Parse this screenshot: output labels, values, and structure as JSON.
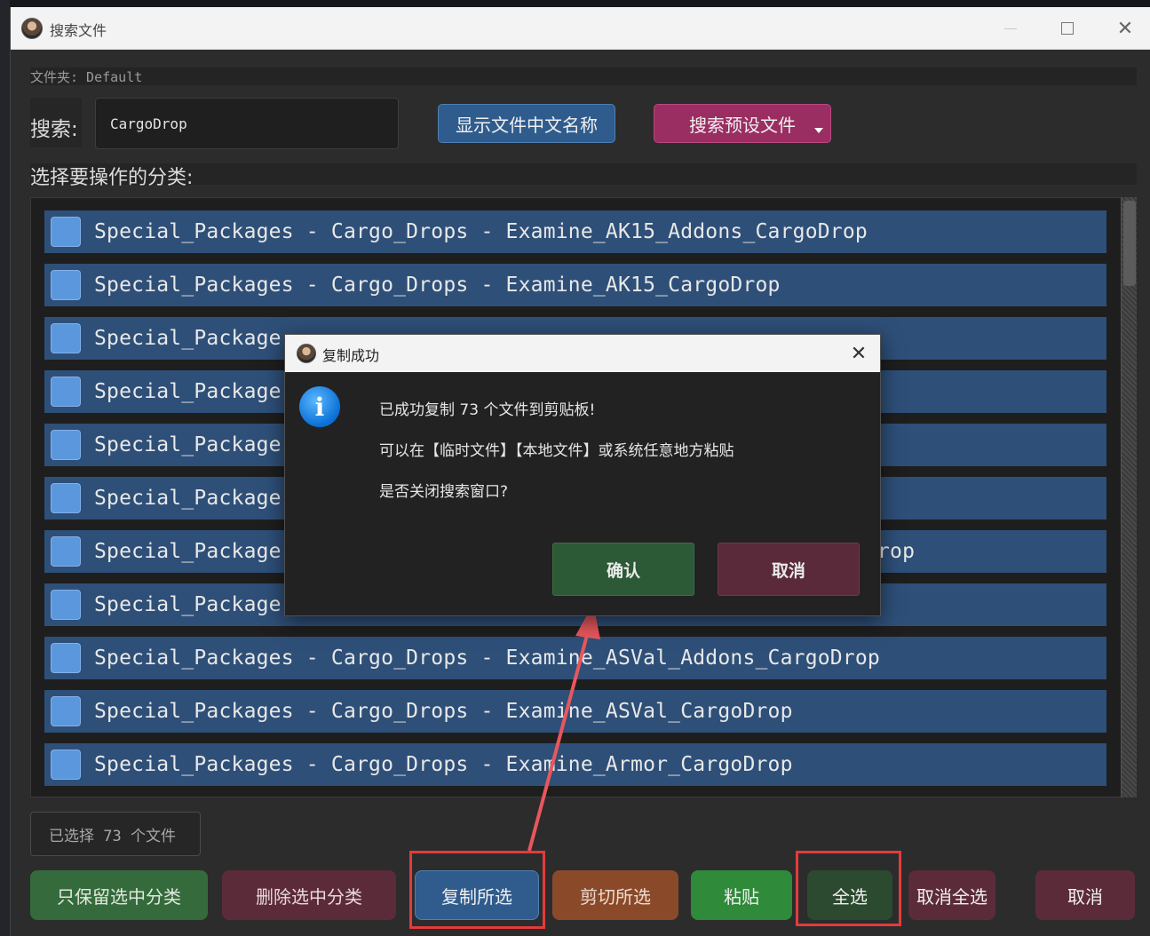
{
  "window": {
    "title": "搜索文件"
  },
  "folder": {
    "text": "文件夹: Default"
  },
  "search": {
    "label": "搜索:",
    "value": "CargoDrop"
  },
  "toolbar": {
    "show_cn_label": "显示文件中文名称",
    "preset_label": "搜索预设文件"
  },
  "category": {
    "label": "选择要操作的分类:"
  },
  "list": {
    "items": [
      "Special_Packages - Cargo_Drops - Examine_AK15_Addons_CargoDrop",
      "Special_Packages - Cargo_Drops - Examine_AK15_CargoDrop",
      "Special_Package",
      "Special_Package",
      "Special_Package",
      "Special_Package",
      "Special_Package",
      "Special_Package",
      "Special_Packages - Cargo_Drops - Examine_ASVal_Addons_CargoDrop",
      "Special_Packages - Cargo_Drops - Examine_ASVal_CargoDrop",
      "Special_Packages - Cargo_Drops - Examine_Armor_CargoDrop"
    ],
    "partial_tail": "rop"
  },
  "status": {
    "selected_count": "已选择 73 个文件"
  },
  "actions": {
    "keep": "只保留选中分类",
    "delete": "删除选中分类",
    "copy": "复制所选",
    "cut": "剪切所选",
    "paste": "粘贴",
    "select_all": "全选",
    "unselect_all": "取消全选",
    "cancel": "取消"
  },
  "dialog": {
    "title": "复制成功",
    "line1": "已成功复制 73 个文件到剪贴板!",
    "line2": "可以在【临时文件】【本地文件】或系统任意地方粘贴",
    "line3": "是否关闭搜索窗口?",
    "confirm": "确认",
    "cancel": "取消",
    "info_glyph": "i"
  },
  "colors": {
    "list_item": "#2e4f78",
    "checkbox": "#5b97dc",
    "highlight": "#e23c3c"
  }
}
